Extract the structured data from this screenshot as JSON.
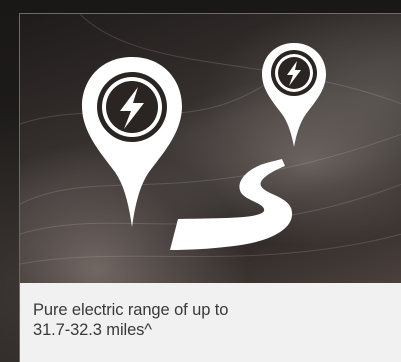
{
  "feature_card": {
    "icon": "electric-range-route-icon",
    "caption_line1": "Pure electric range of up to",
    "caption_line2": "31.7-32.3 miles^"
  },
  "colors": {
    "icon_fill": "#ffffff",
    "card_background": "#f1f1f1",
    "caption_text": "#3a3a3a"
  }
}
